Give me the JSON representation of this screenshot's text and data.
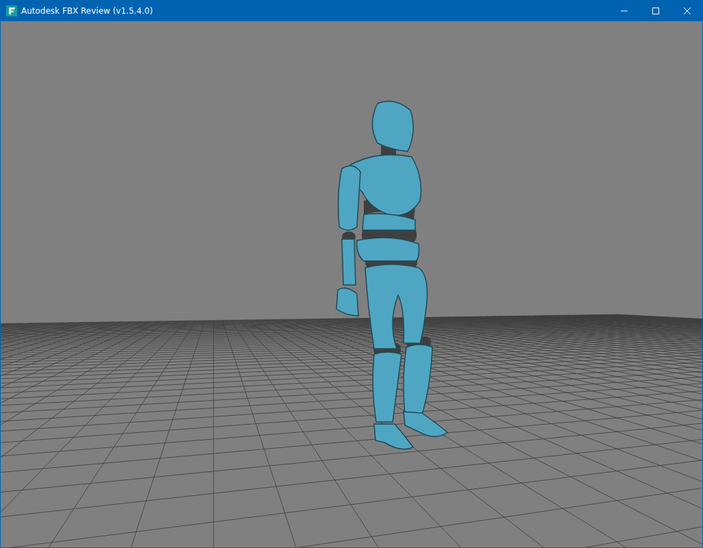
{
  "window": {
    "title": "Autodesk FBX Review (v1.5.4.0)"
  }
}
